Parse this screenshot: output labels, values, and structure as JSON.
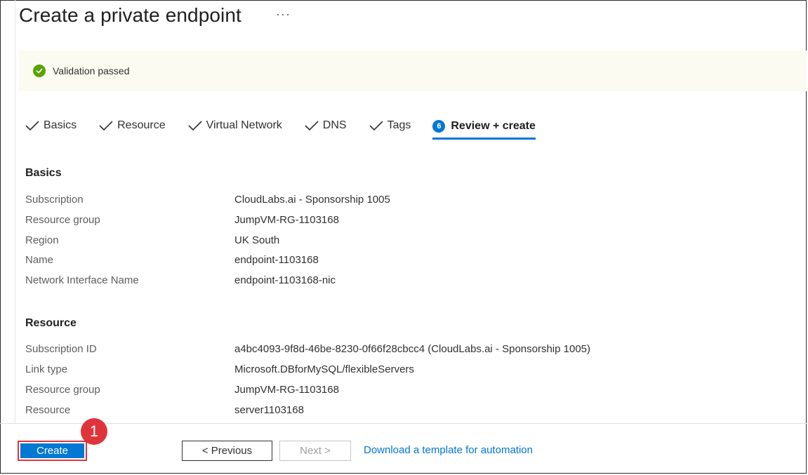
{
  "header": {
    "title": "Create a private endpoint",
    "more": "···"
  },
  "banner": {
    "status": "success",
    "text": "Validation passed",
    "icon": "check-circle-icon",
    "color": "#57a300"
  },
  "tabs": [
    {
      "label": "Basics",
      "state": "completed"
    },
    {
      "label": "Resource",
      "state": "completed"
    },
    {
      "label": "Virtual Network",
      "state": "completed"
    },
    {
      "label": "DNS",
      "state": "completed"
    },
    {
      "label": "Tags",
      "state": "completed"
    },
    {
      "label": "Review + create",
      "state": "active",
      "number": "6"
    }
  ],
  "basics": {
    "title": "Basics",
    "rows": [
      {
        "label": "Subscription",
        "value": "CloudLabs.ai - Sponsorship 1005"
      },
      {
        "label": "Resource group",
        "value": "JumpVM-RG-1103168"
      },
      {
        "label": "Region",
        "value": "UK South"
      },
      {
        "label": "Name",
        "value": "endpoint-1103168"
      },
      {
        "label": "Network Interface Name",
        "value": "endpoint-1103168-nic"
      }
    ]
  },
  "resource": {
    "title": "Resource",
    "rows": [
      {
        "label": "Subscription ID",
        "value": "a4bc4093-9f8d-46be-8230-0f66f28cbcc4 (CloudLabs.ai - Sponsorship 1005)"
      },
      {
        "label": "Link type",
        "value": "Microsoft.DBforMySQL/flexibleServers"
      },
      {
        "label": "Resource group",
        "value": "JumpVM-RG-1103168"
      },
      {
        "label": "Resource",
        "value": "server1103168"
      }
    ]
  },
  "footer": {
    "create_label": "Create",
    "previous_label": "< Previous",
    "next_label": "Next >",
    "download_link": "Download a template for automation"
  },
  "callout": {
    "number": "1",
    "color": "#e0343c"
  },
  "colors": {
    "accent": "#0078d4",
    "highlight": "#e0343c"
  }
}
